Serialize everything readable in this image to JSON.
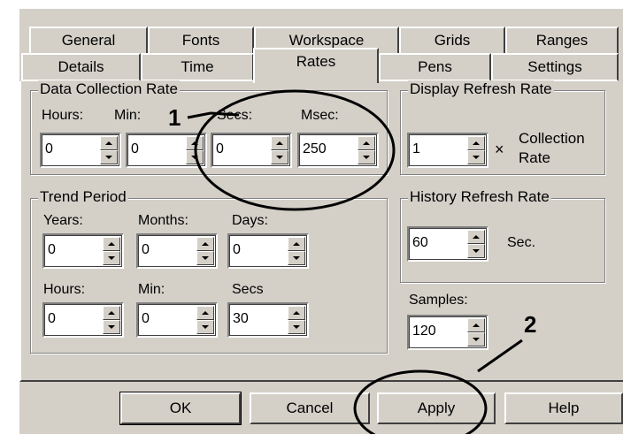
{
  "tabs_back": [
    "General",
    "Fonts",
    "Workspace",
    "Grids",
    "Ranges"
  ],
  "tabs_front": [
    "Details",
    "Time",
    "Rates",
    "Pens",
    "Settings"
  ],
  "data_collection": {
    "title": "Data Collection Rate",
    "labels": {
      "hours": "Hours:",
      "min": "Min:",
      "secs": "Secs:",
      "msec": "Msec:"
    },
    "values": {
      "hours": "0",
      "min": "0",
      "secs": "0",
      "msec": "250"
    }
  },
  "display_refresh": {
    "title": "Display Refresh Rate",
    "value": "1",
    "multiply": "×",
    "label_line1": "Collection",
    "label_line2": "Rate"
  },
  "trend_period": {
    "title": "Trend Period",
    "labels": {
      "years": "Years:",
      "months": "Months:",
      "days": "Days:",
      "hours": "Hours:",
      "min": "Min:",
      "secs": "Secs"
    },
    "values": {
      "years": "0",
      "months": "0",
      "days": "0",
      "hours": "0",
      "min": "0",
      "secs": "30"
    }
  },
  "history_refresh": {
    "title": "History Refresh Rate",
    "value": "60",
    "unit": "Sec."
  },
  "samples": {
    "label": "Samples:",
    "value": "120"
  },
  "buttons": {
    "ok": "OK",
    "cancel": "Cancel",
    "apply": "Apply",
    "help": "Help"
  },
  "annotations": {
    "one": "1",
    "two": "2"
  }
}
